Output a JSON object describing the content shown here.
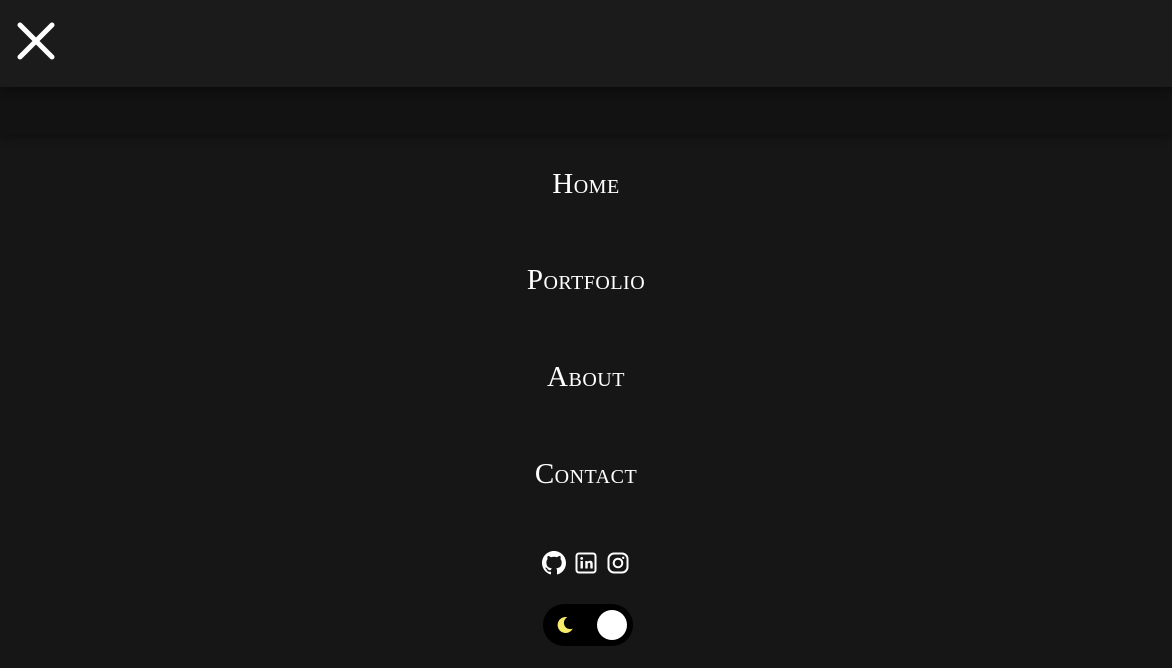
{
  "header": {
    "close_icon": "close-icon"
  },
  "nav": {
    "items": [
      {
        "label": "Home"
      },
      {
        "label": "Portfolio"
      },
      {
        "label": "About"
      },
      {
        "label": "Contact"
      }
    ]
  },
  "socials": [
    {
      "name": "GitHub",
      "icon": "github-icon"
    },
    {
      "name": "LinkedIn",
      "icon": "linkedin-icon"
    },
    {
      "name": "Instagram",
      "icon": "instagram-icon"
    }
  ],
  "theme_toggle": {
    "icon": "moon-icon",
    "mode": "dark",
    "moon_color": "#f5ea6a",
    "track_color": "#000000",
    "knob_color": "#ffffff"
  },
  "colors": {
    "background": "#161616",
    "header": "#1b1b1b",
    "text": "#ffffff"
  }
}
